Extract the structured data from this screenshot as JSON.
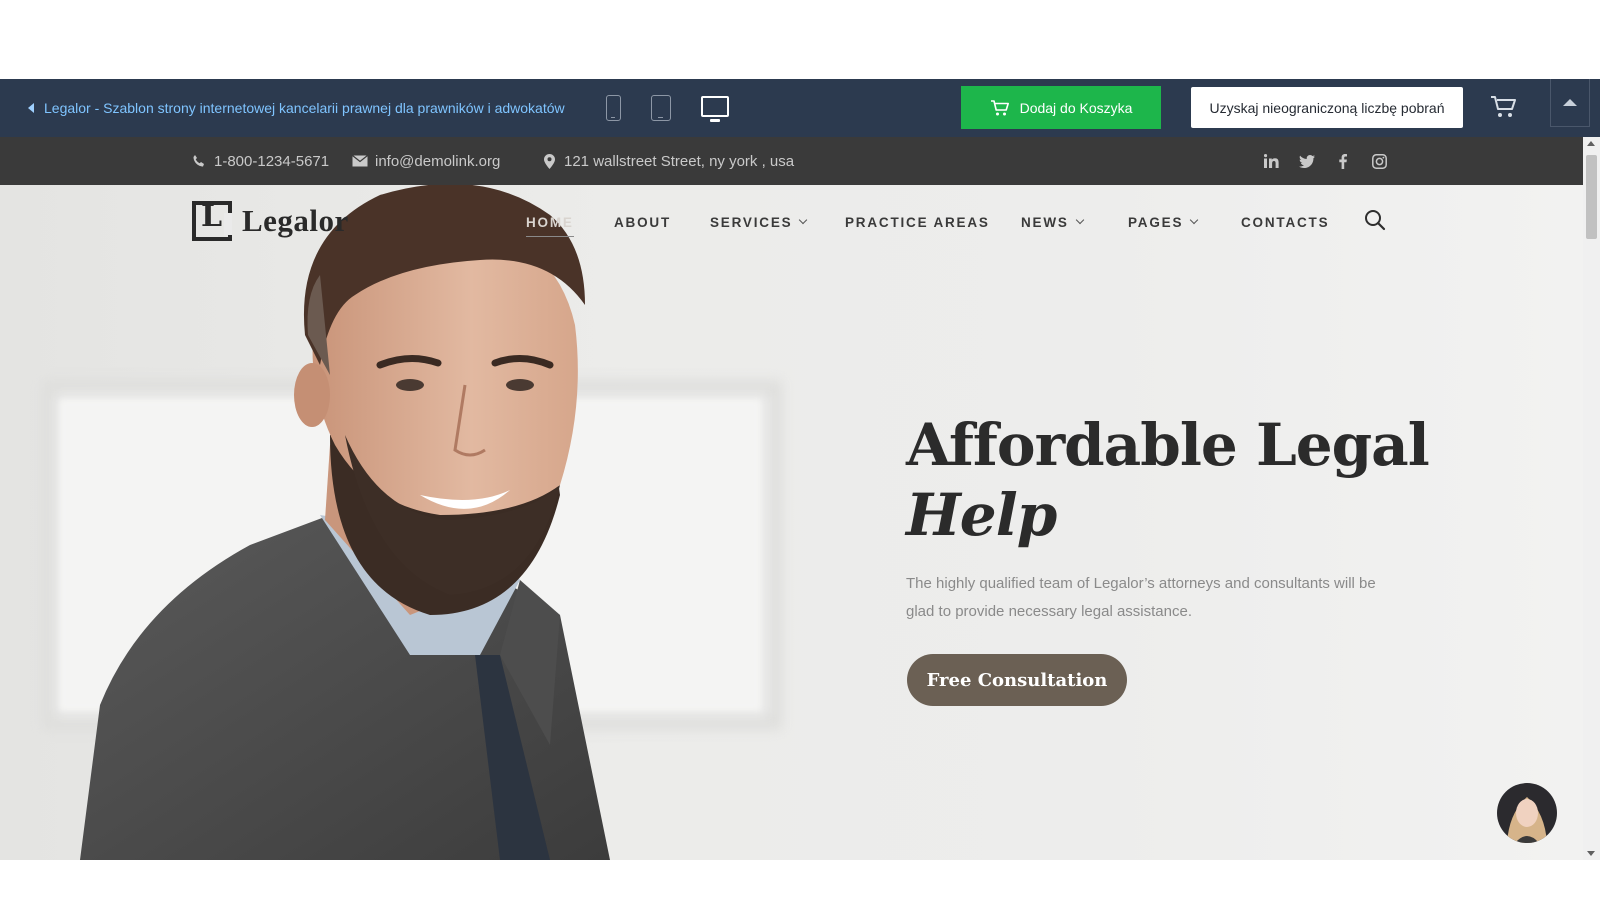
{
  "preview_bar": {
    "back_link": "Legalor - Szablon strony internetowej kancelarii prawnej dla prawników i adwokatów",
    "devices": [
      "phone-icon",
      "tablet-icon",
      "desktop-icon"
    ],
    "add_to_cart": "Dodaj do Koszyka",
    "unlimited": "Uzyskaj nieograniczoną liczbę pobrań",
    "colors": {
      "bar_bg": "#2c3a4f",
      "add_to_cart_bg": "#1db64b",
      "link": "#7fc4ff"
    }
  },
  "info_bar": {
    "phone": "1-800-1234-5671",
    "email": "info@demolink.org",
    "address": "121 wallstreet Street, ny york , usa",
    "socials": [
      "linkedin-icon",
      "twitter-icon",
      "facebook-icon",
      "instagram-icon"
    ]
  },
  "site": {
    "logo_text": "Legalor",
    "nav": [
      {
        "label": "HOME",
        "active": true,
        "dropdown": false
      },
      {
        "label": "ABOUT",
        "active": false,
        "dropdown": false
      },
      {
        "label": "SERVICES",
        "active": false,
        "dropdown": true
      },
      {
        "label": "PRACTICE AREAS",
        "active": false,
        "dropdown": false
      },
      {
        "label": "NEWS",
        "active": false,
        "dropdown": true
      },
      {
        "label": "PAGES",
        "active": false,
        "dropdown": true
      },
      {
        "label": "CONTACTS",
        "active": false,
        "dropdown": false
      }
    ]
  },
  "hero": {
    "title_line1": "Affordable Legal",
    "title_line2": "Help",
    "subtitle": "The highly qualified team of Legalor’s attorneys and consultants will be glad to provide necessary legal assistance.",
    "cta": "Free Consultation",
    "colors": {
      "cta_bg": "#6b6054",
      "title": "#2b2b2b"
    }
  }
}
